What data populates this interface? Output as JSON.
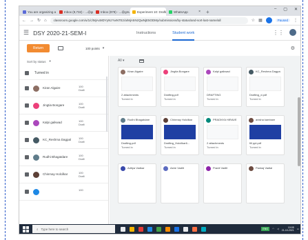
{
  "browser": {
    "tabs": [
      {
        "title": "You are organizing a meeting (Dr. ...",
        "color": "#5b6bd8",
        "active": false
      },
      {
        "title": "Inbox (9,732) - ...@gmail.com",
        "color": "#d93025",
        "active": false
      },
      {
        "title": "Inbox (879) - ...@gmail.com",
        "color": "#d93025",
        "active": false
      },
      {
        "title": "Experiment 10: Drafting",
        "color": "#f4b400",
        "active": true
      },
      {
        "title": "WhatsApp",
        "color": "#25d366",
        "active": false
      }
    ],
    "new_tab": "+",
    "url": "classroom.google.com/u/1/c/MjAxMDYyNzYwNTEz/a/MjA5NzQwNjE5ODMy/submissions/by-status/and-sort-last-name/all",
    "paused_label": "Paused"
  },
  "classroom": {
    "class_name": "DSY 2020-21-SEM-I",
    "nav_tabs": [
      {
        "label": "Instructions",
        "active": false
      },
      {
        "label": "Student work",
        "active": true
      }
    ],
    "return_button": "Return",
    "points": "100 points",
    "sort_label": "Sort by status",
    "filter_label": "All",
    "section_label": "Turned in"
  },
  "students": [
    {
      "name": "Kiran Algaire",
      "grade": "100",
      "sub": "Draft",
      "color": "#8d6e63"
    },
    {
      "name": "Jingtia Bongare",
      "grade": "100",
      "sub": "Draft",
      "color": "#ec407a"
    },
    {
      "name": "Kalpi gaikwad",
      "grade": "100",
      "sub": "Draft",
      "color": "#ab47bc"
    },
    {
      "name": "KC_Reshma Dagpal",
      "grade": "100",
      "sub": "Draft",
      "color": "#455a64"
    },
    {
      "name": "Rudhi Bhagatdare",
      "grade": "100",
      "sub": "Draft",
      "color": "#607d8b"
    },
    {
      "name": "Chinmay Holcilkar",
      "grade": "100",
      "sub": "Draft",
      "color": "#5d4037"
    },
    {
      "name": "",
      "grade": "100",
      "sub": "",
      "color": "#1e88e5"
    }
  ],
  "cards": [
    {
      "name": "Kiran Algaire",
      "file": "2 attachments",
      "status": "Turned in",
      "thumb": "plain",
      "color": "#8d6e63"
    },
    {
      "name": "Jingtia Bongare",
      "file": "Drafting.pdf",
      "status": "Turned in",
      "thumb": "plain",
      "color": "#ec407a"
    },
    {
      "name": "Kalpi gaikwad",
      "file": "DRAFTING",
      "status": "Turned in",
      "thumb": "plain",
      "color": "#ab47bc"
    },
    {
      "name": "KC_Reshma Dagpal",
      "file": "Drafting_d.pdf",
      "status": "Turned in",
      "thumb": "plain",
      "color": "#455a64"
    },
    {
      "name": "Rudhi Bhagatdare",
      "file": "Drafting.pdf",
      "status": "Turned in",
      "thumb": "blue",
      "color": "#607d8b"
    },
    {
      "name": "Chinmay Holcilkar",
      "file": "Drafting_Holcilkar6...",
      "status": "Turned in",
      "thumb": "blue",
      "color": "#5d4037"
    },
    {
      "name": "PRADNYA HIRAVE",
      "file": "2 attachments",
      "status": "Turned in",
      "thumb": "plain",
      "color": "#00897b"
    },
    {
      "name": "anisha kambare",
      "file": "fill ppt.pdf",
      "status": "Turned in",
      "thumb": "blue",
      "color": "#6d4c41"
    },
    {
      "name": "Aditya Vadkar",
      "file": "",
      "status": "",
      "thumb": "none",
      "color": "#3949ab"
    },
    {
      "name": "Ashe Vadlit",
      "file": "",
      "status": "",
      "thumb": "none",
      "color": "#5c6bc0"
    },
    {
      "name": "Pranit Vadlit",
      "file": "",
      "status": "",
      "thumb": "none",
      "color": "#8e24aa"
    },
    {
      "name": "Pankaj Vadlal",
      "file": "",
      "status": "",
      "thumb": "none",
      "color": "#6d4c41"
    }
  ],
  "taskbar": {
    "search_placeholder": "Type here to search",
    "apps": [
      "#e8eaed",
      "#f4b400",
      "#e53935",
      "#1e88e5",
      "#43a047",
      "#fb8c00",
      "#1a73e8",
      "#e8eaed",
      "#ff7043",
      "#00acc1"
    ],
    "lang": "ENG",
    "time": "10:05",
    "date": "21-10-2021"
  }
}
